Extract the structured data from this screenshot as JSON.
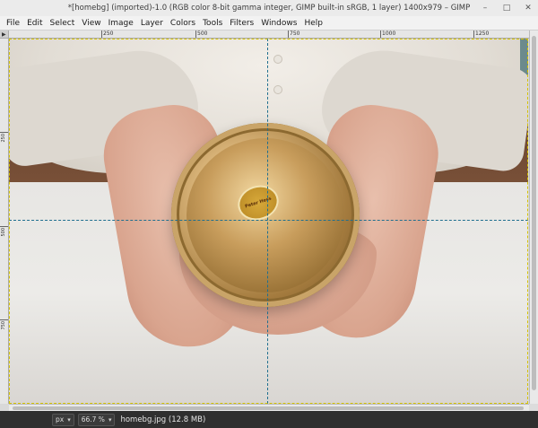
{
  "window": {
    "title": "*[homebg] (imported)-1.0 (RGB color 8-bit gamma integer, GIMP built-in sRGB, 1 layer) 1400x979 – GIMP",
    "controls": [
      "–",
      "□",
      "✕"
    ]
  },
  "menubar": {
    "items": [
      "File",
      "Edit",
      "Select",
      "View",
      "Image",
      "Layer",
      "Colors",
      "Tools",
      "Filters",
      "Windows",
      "Help"
    ]
  },
  "rulers": {
    "horizontal": [
      "250",
      "500",
      "750",
      "1000",
      "1250"
    ],
    "vertical": [
      "250",
      "500",
      "750"
    ]
  },
  "canvas": {
    "sticker_text": "Peter Hess"
  },
  "statusbar": {
    "unit": "px",
    "zoom": "66.7 %",
    "file_info": "homebg.jpg (12.8 MB)"
  },
  "colors": {
    "guide": "#1f6f8f",
    "boundary": "#d4c200",
    "statusbar_bg": "#2f2f2f"
  }
}
